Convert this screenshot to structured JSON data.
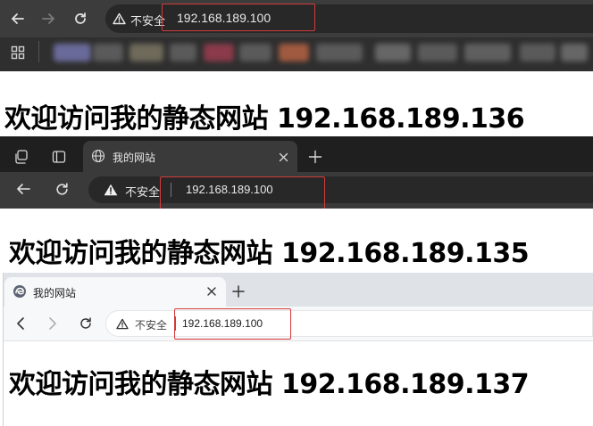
{
  "window1": {
    "security_label": "不安全",
    "url": "192.168.189.100",
    "page_heading": "欢迎访问我的静态网站 192.168.189.136",
    "icons": [
      "back-arrow-icon",
      "forward-arrow-icon",
      "reload-icon",
      "warning-triangle-icon",
      "apps-grid-icon"
    ]
  },
  "window2": {
    "tab_title": "我的网站",
    "security_label": "不安全",
    "url": "192.168.189.100",
    "page_heading": "欢迎访问我的静态网站 192.168.189.135",
    "icons": [
      "workspaces-icon",
      "tab-actions-icon",
      "globe-icon",
      "close-icon",
      "plus-icon",
      "back-arrow-icon",
      "reload-icon",
      "warning-triangle-icon"
    ]
  },
  "window3": {
    "tab_title": "我的网站",
    "security_label": "不安全",
    "url": "192.168.189.100",
    "page_heading": "欢迎访问我的静态网站 192.168.189.137",
    "icons": [
      "browser-logo-icon",
      "close-icon",
      "plus-icon",
      "back-chevron-icon",
      "forward-chevron-icon",
      "reload-icon",
      "warning-triangle-icon"
    ]
  },
  "colors": {
    "highlight": "#d23b3b",
    "dark_toolbar": "#3c3c3c",
    "dark_omnibox": "#282828",
    "light_tabstrip": "#dfe3e8"
  }
}
